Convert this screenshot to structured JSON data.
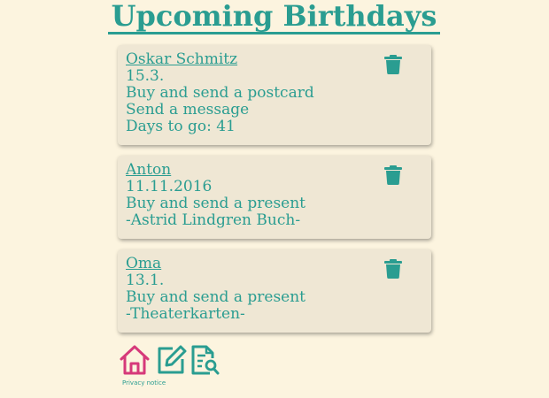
{
  "page": {
    "title": "Upcoming Birthdays"
  },
  "colors": {
    "background": "#fcf4df",
    "card": "#efe7d4",
    "accent": "#2a9d91",
    "home_icon": "#d6397a"
  },
  "birthdays": [
    {
      "name": "Oskar Schmitz",
      "date": "15.3.",
      "details": [
        "Buy and send a postcard",
        "Send a message",
        "Days to go: 41"
      ],
      "action_icon": "trash-icon"
    },
    {
      "name": "Anton",
      "date": "11.11.2016",
      "details": [
        "Buy and send a present",
        "-Astrid Lindgren Buch-"
      ],
      "action_icon": "trash-icon"
    },
    {
      "name": "Oma",
      "date": "13.1.",
      "details": [
        "Buy and send a present",
        "-Theaterkarten-"
      ],
      "action_icon": "trash-icon"
    }
  ],
  "footer": {
    "icons": [
      "home-icon",
      "edit-icon",
      "search-document-icon"
    ],
    "privacy_label": "Privacy notice"
  }
}
